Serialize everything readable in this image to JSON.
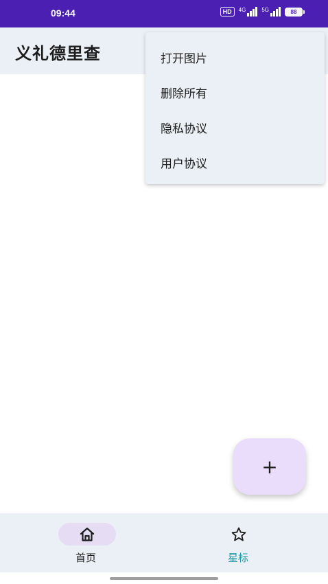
{
  "status_bar": {
    "time": "09:44",
    "hd_badge": "HD",
    "signal_1_tag": "4G",
    "signal_2_tag": "5G",
    "battery": "88",
    "background_color": "#4a1fb2"
  },
  "app_bar": {
    "title": "义礼德里查"
  },
  "menu": {
    "items": [
      {
        "label": "打开图片"
      },
      {
        "label": "删除所有"
      },
      {
        "label": "隐私协议"
      },
      {
        "label": "用户协议"
      }
    ]
  },
  "fab": {
    "icon": "plus-icon",
    "symbol": "+"
  },
  "bottom_nav": {
    "items": [
      {
        "label": "首页",
        "icon": "home-icon",
        "selected": true
      },
      {
        "label": "星标",
        "icon": "star-outline-icon",
        "selected": false
      }
    ],
    "accent_color": "#1a9aa8"
  }
}
